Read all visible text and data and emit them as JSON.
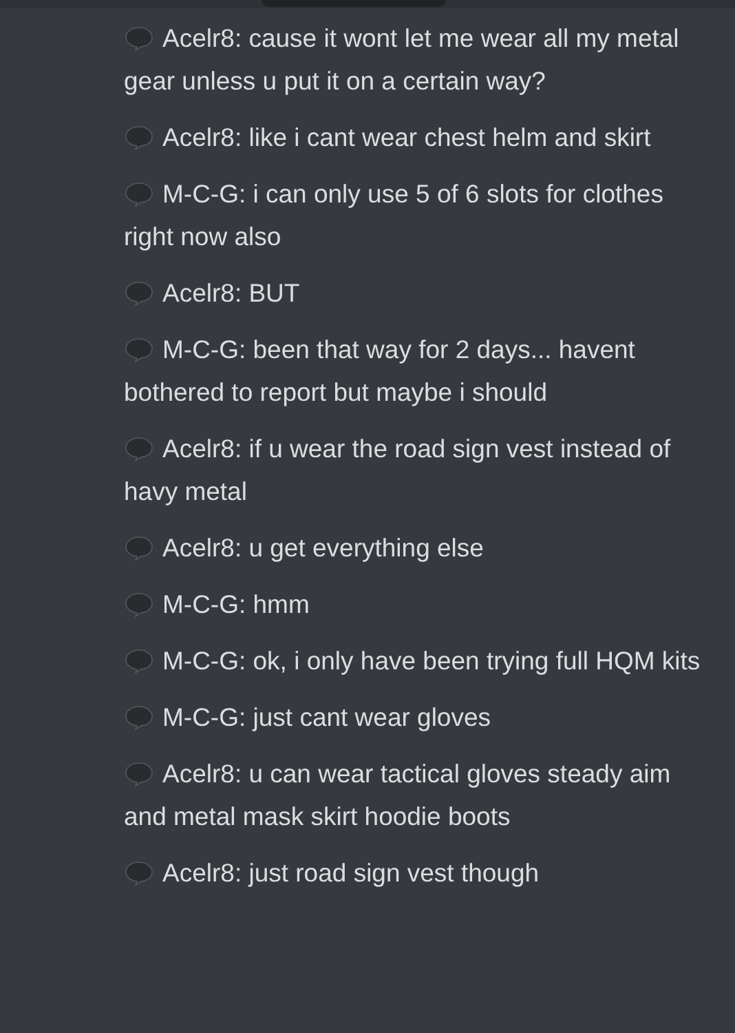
{
  "messages": [
    {
      "text": "Acelr8: cause it wont let me wear all my metal gear unless u put it on a certain way?"
    },
    {
      "text": "Acelr8: like i cant wear chest helm and skirt"
    },
    {
      "text": "M-C-G: i can only use 5 of 6 slots for clothes right now also"
    },
    {
      "text": "Acelr8: BUT"
    },
    {
      "text": "M-C-G: been that way for 2 days... havent bothered to report but maybe i should"
    },
    {
      "text": "Acelr8: if u wear the road sign vest instead of havy metal"
    },
    {
      "text": "Acelr8: u get everything else"
    },
    {
      "text": "M-C-G: hmm"
    },
    {
      "text": "M-C-G: ok, i only have been trying full HQM kits"
    },
    {
      "text": "M-C-G: just cant wear gloves"
    },
    {
      "text": "Acelr8: u can wear tactical gloves steady aim and metal mask skirt hoodie boots"
    },
    {
      "text": "Acelr8: just road sign vest though"
    }
  ]
}
